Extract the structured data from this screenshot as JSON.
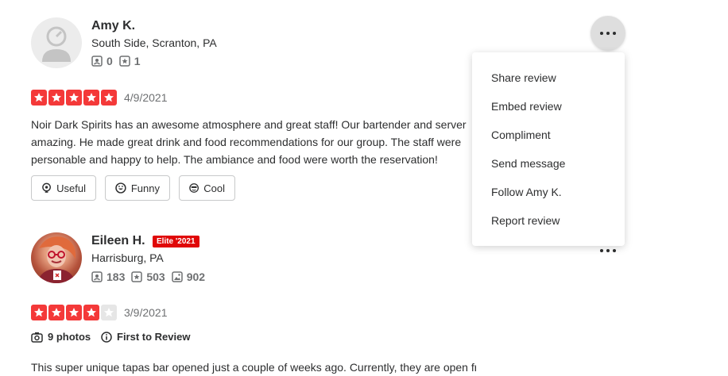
{
  "reviews": [
    {
      "name": "Amy K.",
      "location": "South Side, Scranton, PA",
      "friends": "0",
      "reviews_count": "1",
      "rating": 5,
      "date": "4/9/2021",
      "text_lines": [
        "Noir Dark Spirits has an awesome atmosphere and great staff! Our bartender and server",
        "amazing. He made great drink and food recommendations for our group. The staff were",
        "personable and happy to help. The ambiance and food were worth the reservation!"
      ],
      "reactions": {
        "useful": "Useful",
        "funny": "Funny",
        "cool": "Cool"
      }
    },
    {
      "name": "Eileen H.",
      "elite_badge": "Elite '2021",
      "location": "Harrisburg, PA",
      "friends": "183",
      "reviews_count": "503",
      "photos_count": "902",
      "rating": 4,
      "date": "3/9/2021",
      "photos_label": "9 photos",
      "first_to_review": "First to Review",
      "text_preview": "This super unique tapas bar opened just a couple of weeks ago.  Currently, they are open from"
    }
  ],
  "menu": {
    "items": [
      "Share review",
      "Embed review",
      "Compliment",
      "Send message",
      "Follow Amy K.",
      "Report review"
    ]
  },
  "colors": {
    "star_red": "#f43939",
    "elite_red": "#e00707",
    "muted": "#6e7072"
  }
}
